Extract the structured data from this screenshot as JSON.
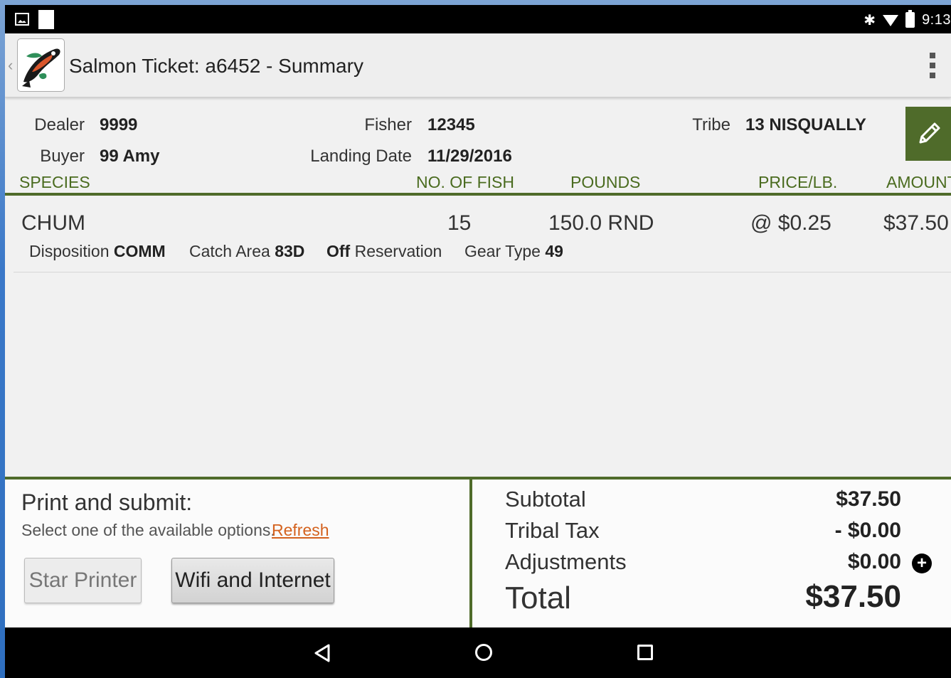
{
  "status_bar": {
    "time": "9:13",
    "icons": [
      "image-icon",
      "document-icon",
      "bluetooth-icon",
      "wifi-icon",
      "battery-icon"
    ]
  },
  "action_bar": {
    "title": "Salmon Ticket: a6452 - Summary",
    "logo": "salmon-logo",
    "overflow": "overflow-menu-icon"
  },
  "header": {
    "dealer_label": "Dealer",
    "dealer_value": "9999",
    "buyer_label": "Buyer",
    "buyer_value": "99 Amy",
    "fisher_label": "Fisher",
    "fisher_value": "12345",
    "landing_label": "Landing Date",
    "landing_value": "11/29/2016",
    "tribe_label": "Tribe",
    "tribe_value": "13 NISQUALLY",
    "edit_icon": "pencil-icon"
  },
  "columns": {
    "species": "SPECIES",
    "no_of_fish": "NO. OF FISH",
    "pounds": "POUNDS",
    "price": "PRICE/LB.",
    "amount": "AMOUNT"
  },
  "items": [
    {
      "species": "CHUM",
      "no_of_fish": "15",
      "pounds": "150.0 RND",
      "price": "@ $0.25",
      "amount": "$37.50",
      "disposition_label": "Disposition",
      "disposition_value": "COMM",
      "catch_area_label": "Catch Area",
      "catch_area_value": "83D",
      "reservation_value": "Off",
      "reservation_label": "Reservation",
      "gear_type_label": "Gear Type",
      "gear_type_value": "49"
    }
  ],
  "print": {
    "title": "Print and submit:",
    "subtitle": "Select one of the available options.",
    "refresh": "Refresh",
    "star_printer": "Star Printer",
    "wifi_internet": "Wifi and Internet"
  },
  "totals": {
    "subtotal_label": "Subtotal",
    "subtotal_value": "$37.50",
    "tax_label": "Tribal Tax",
    "tax_value": "- $0.00",
    "adjustments_label": "Adjustments",
    "adjustments_value": "$0.00",
    "total_label": "Total",
    "total_value": "$37.50",
    "add_icon": "plus-circle-icon"
  },
  "colors": {
    "accent_green": "#4f6b2a",
    "link_orange": "#d4621e"
  }
}
